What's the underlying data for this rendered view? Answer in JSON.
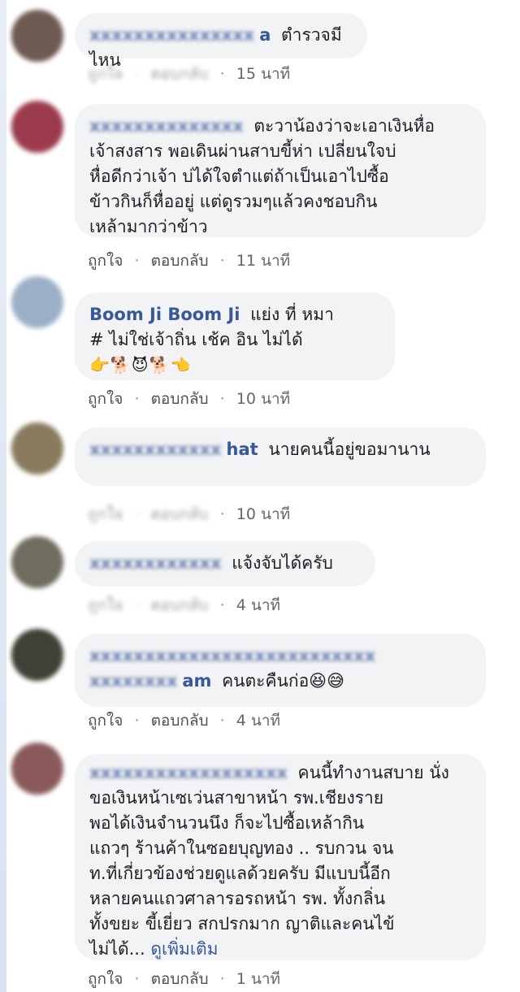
{
  "action_labels": {
    "like": "ถูกใจ",
    "reply": "ตอบกลับ",
    "separator": "·"
  },
  "comments": [
    {
      "name": "a",
      "text": "ตำรวจมีไหน",
      "time": "15 นาที",
      "avatar_color": "#6e5a52"
    },
    {
      "name": "",
      "text": "ตะวาน้องว่าจะเอาเงินหื่อ\nเจ้าสงสาร พอเดินผ่านสาบขี้ห่า เปลี่ยนใจบ่\nหื่อดีกว่าเจ้า บ่ได้ใจตำแต่ถ้าเป็นเอาไปซื้อ\nข้าวกินก็หื่ออยู่ แต่ดูรวมๆแล้วคงชอบกิน\nเหล้ามากว่าข้าว",
      "time": "11 นาที",
      "avatar_color": "#9c3b4e"
    },
    {
      "name": "Boom Ji Boom Ji",
      "text": "แย่ง ที่ หมา\n# ไม่ใช่เจ้าถิ่น เช้ค อิน ไม่ได้",
      "emoji": "👉🐕😈🐕👈",
      "time": "10 นาที",
      "avatar_color": "#9bb0c7"
    },
    {
      "name": "hat",
      "text": "นายคนนี้อยู่ขอมานาน",
      "time": "10 นาที",
      "avatar_color": "#8a7a5e"
    },
    {
      "name": "",
      "text": "แจ้งจับได้ครับ",
      "time": "4 นาที",
      "avatar_color": "#706c60"
    },
    {
      "name": "am",
      "text": "คนตะคืนก่อ😆😅",
      "time": "4 นาที",
      "avatar_color": "#3e4135"
    },
    {
      "name": "",
      "text": "คนนี้ทำงานสบาย นั่ง\nขอเงินหน้าเซเว่นสาขาหน้า รพ.เชียงราย\nพอได้เงินจำนวนนึง ก็จะไปซื้อเหล้ากิน\nแถวๆ ร้านค้าในซอยบุญทอง .. รบกวน จน\nท.ที่เกี่ยวข้องช่วยดูแลด้วยครับ มีแบบนี้อีก\nหลายคนแถวศาลารอรถหน้า รพ. ทั้งกลิ่น\nทั้งขยะ ขี้เยี่ยว สกปรกมาก ญาติและคนไข้\nไม่ได้...",
      "see_more": "ดูเพิ่มเติม",
      "time": "1 นาที",
      "avatar_color": "#8a5a5a"
    }
  ]
}
